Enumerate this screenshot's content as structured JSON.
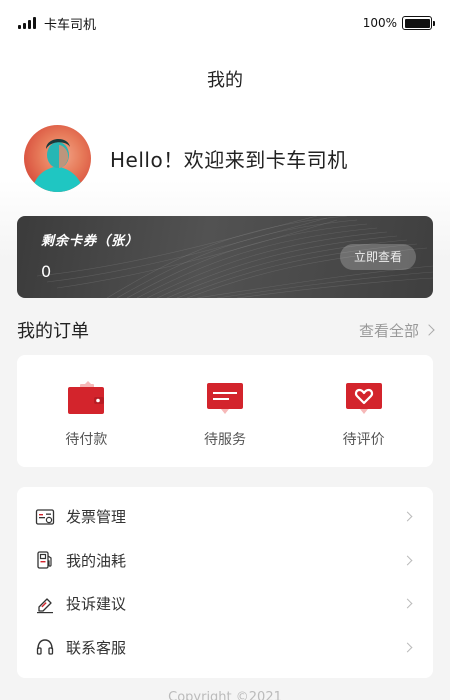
{
  "status_bar": {
    "carrier": "卡车司机",
    "battery": "100%"
  },
  "header": {
    "title": "我的"
  },
  "profile": {
    "greeting": "Hello！欢迎来到卡车司机"
  },
  "coupon": {
    "title": "剩余卡券（张）",
    "count": "0",
    "button": "立即查看"
  },
  "orders": {
    "title": "我的订单",
    "view_all": "查看全部",
    "items": [
      {
        "label": "待付款",
        "icon": "wallet-icon"
      },
      {
        "label": "待服务",
        "icon": "message-icon"
      },
      {
        "label": "待评价",
        "icon": "heart-message-icon"
      }
    ]
  },
  "menu": {
    "items": [
      {
        "label": "发票管理",
        "icon": "invoice-icon"
      },
      {
        "label": "我的油耗",
        "icon": "fuel-icon"
      },
      {
        "label": "投诉建议",
        "icon": "edit-icon"
      },
      {
        "label": "联系客服",
        "icon": "headset-icon"
      }
    ]
  },
  "footer": {
    "copyright": "Copyright ©2021"
  },
  "colors": {
    "accent": "#d3242c",
    "card_dark": "#4a4a4a",
    "background": "#f4f4f4"
  }
}
